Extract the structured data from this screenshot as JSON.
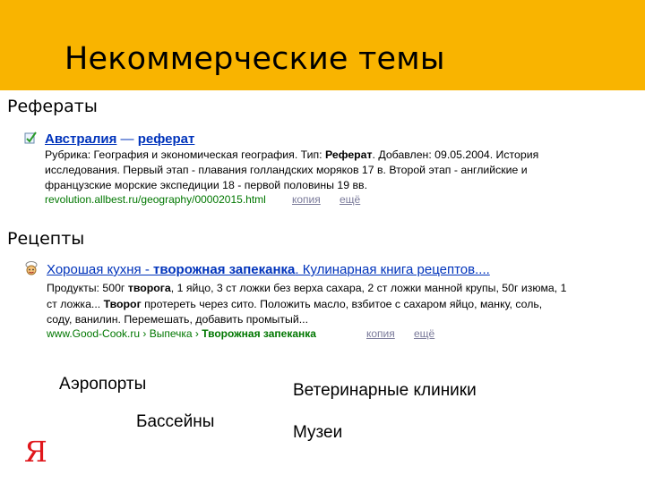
{
  "header": {
    "title": "Некоммерческие темы",
    "accent": "#f9b400"
  },
  "sections": {
    "essays": "Рефераты",
    "recipes": "Рецепты"
  },
  "result1": {
    "title_a": "Австралия",
    "title_sep": " — ",
    "title_b": "реферат",
    "line1_a": "Рубрика: География и экономическая география. Тип: ",
    "line1_b": "Реферат",
    "line1_c": ". Добавлен: 09.05.2004. История",
    "line2": "исследования. Первый этап - плавания голландских моряков 17 в. Второй этап - английские и",
    "line3": "французские морские экспедиции 18 - первой половины 19 вв.",
    "url": "revolution.allbest.ru/geography/00002015.html",
    "copy": "копия",
    "more": "ещё"
  },
  "result2": {
    "title_a": "Хорошая кухня - ",
    "title_b": "творожная запеканка",
    "title_c": ". Кулинарная книга рецептов....",
    "line1_a": "Продукты: 500г ",
    "line1_b": "творога",
    "line1_c": ", 1 яйцо, 3 ст ложки без верха сахара, 2 ст ложки манной крупы, 50г изюма, 1",
    "line2_a": "ст ложка... ",
    "line2_b": "Творог",
    "line2_c": " протереть через сито. Положить масло, взбитое с сахаром яйцо, манку, соль,",
    "line3": "соду, ванилин. Перемешать, добавить промытый...",
    "url_a": "www.Good-Cook.ru",
    "url_sep1": " › ",
    "url_b": "Выпечка",
    "url_sep2": " › ",
    "url_c": "Творожная запеканка",
    "copy": "копия",
    "more": "ещё"
  },
  "topics": {
    "airports": "Аэропорты",
    "vet": "Ветеринарные клиники",
    "pools": "Бассейны",
    "museums": "Музеи"
  },
  "logo": {
    "text": "Я",
    "color": "#e0171c"
  }
}
